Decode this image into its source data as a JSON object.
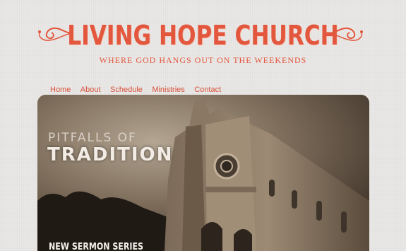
{
  "header": {
    "title": "LIVING HOPE CHURCH",
    "tagline": "WHERE GOD HANGS OUT ON THE WEEKENDS"
  },
  "nav": {
    "items": [
      "Home",
      "About",
      "Schedule",
      "Ministries",
      "Contact"
    ]
  },
  "hero": {
    "title_small": "PITFALLS OF",
    "title_big": "TRADITION",
    "label": "NEW SERMON SERIES"
  },
  "colors": {
    "accent": "#e2573d",
    "background": "#eae8e6"
  }
}
